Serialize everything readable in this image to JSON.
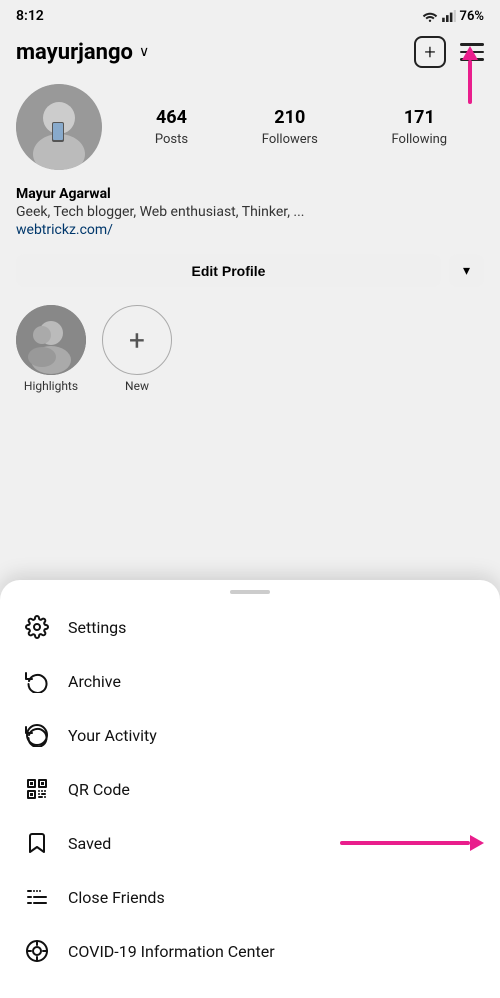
{
  "statusBar": {
    "time": "8:12",
    "battery": "76%"
  },
  "header": {
    "username": "mayurjango",
    "addIcon": "+",
    "chevron": "∨"
  },
  "profile": {
    "name": "Mayur Agarwal",
    "bio": "Geek, Tech blogger, Web enthusiast, Thinker, ...",
    "link": "webtrickz.com/",
    "posts": "464",
    "postsLabel": "Posts",
    "followers": "210",
    "followersLabel": "Followers",
    "following": "171",
    "followingLabel": "Following"
  },
  "buttons": {
    "editProfile": "Edit Profile",
    "dropdown": "⌄"
  },
  "highlights": [
    {
      "label": "Highlights",
      "type": "image"
    },
    {
      "label": "New",
      "type": "add"
    }
  ],
  "menu": {
    "handleLabel": "",
    "items": [
      {
        "id": "settings",
        "label": "Settings",
        "icon": "settings"
      },
      {
        "id": "archive",
        "label": "Archive",
        "icon": "archive"
      },
      {
        "id": "activity",
        "label": "Your Activity",
        "icon": "activity"
      },
      {
        "id": "qrcode",
        "label": "QR Code",
        "icon": "qrcode"
      },
      {
        "id": "saved",
        "label": "Saved",
        "icon": "saved"
      },
      {
        "id": "closefriends",
        "label": "Close Friends",
        "icon": "closefriends"
      },
      {
        "id": "covid",
        "label": "COVID-19 Information Center",
        "icon": "covid"
      }
    ]
  }
}
